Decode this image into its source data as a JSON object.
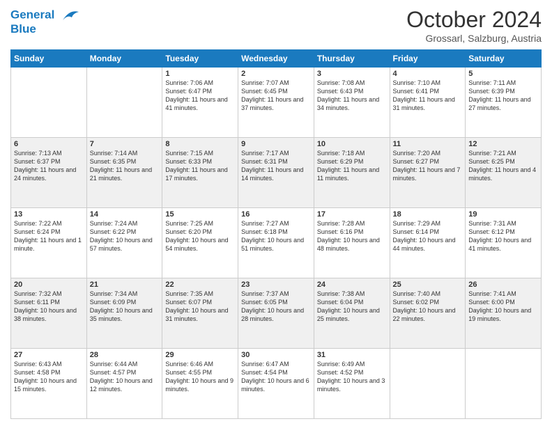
{
  "header": {
    "logo_line1": "General",
    "logo_line2": "Blue",
    "month": "October 2024",
    "location": "Grossarl, Salzburg, Austria"
  },
  "days_of_week": [
    "Sunday",
    "Monday",
    "Tuesday",
    "Wednesday",
    "Thursday",
    "Friday",
    "Saturday"
  ],
  "weeks": [
    [
      {
        "day": "",
        "sunrise": "",
        "sunset": "",
        "daylight": ""
      },
      {
        "day": "",
        "sunrise": "",
        "sunset": "",
        "daylight": ""
      },
      {
        "day": "1",
        "sunrise": "Sunrise: 7:06 AM",
        "sunset": "Sunset: 6:47 PM",
        "daylight": "Daylight: 11 hours and 41 minutes."
      },
      {
        "day": "2",
        "sunrise": "Sunrise: 7:07 AM",
        "sunset": "Sunset: 6:45 PM",
        "daylight": "Daylight: 11 hours and 37 minutes."
      },
      {
        "day": "3",
        "sunrise": "Sunrise: 7:08 AM",
        "sunset": "Sunset: 6:43 PM",
        "daylight": "Daylight: 11 hours and 34 minutes."
      },
      {
        "day": "4",
        "sunrise": "Sunrise: 7:10 AM",
        "sunset": "Sunset: 6:41 PM",
        "daylight": "Daylight: 11 hours and 31 minutes."
      },
      {
        "day": "5",
        "sunrise": "Sunrise: 7:11 AM",
        "sunset": "Sunset: 6:39 PM",
        "daylight": "Daylight: 11 hours and 27 minutes."
      }
    ],
    [
      {
        "day": "6",
        "sunrise": "Sunrise: 7:13 AM",
        "sunset": "Sunset: 6:37 PM",
        "daylight": "Daylight: 11 hours and 24 minutes."
      },
      {
        "day": "7",
        "sunrise": "Sunrise: 7:14 AM",
        "sunset": "Sunset: 6:35 PM",
        "daylight": "Daylight: 11 hours and 21 minutes."
      },
      {
        "day": "8",
        "sunrise": "Sunrise: 7:15 AM",
        "sunset": "Sunset: 6:33 PM",
        "daylight": "Daylight: 11 hours and 17 minutes."
      },
      {
        "day": "9",
        "sunrise": "Sunrise: 7:17 AM",
        "sunset": "Sunset: 6:31 PM",
        "daylight": "Daylight: 11 hours and 14 minutes."
      },
      {
        "day": "10",
        "sunrise": "Sunrise: 7:18 AM",
        "sunset": "Sunset: 6:29 PM",
        "daylight": "Daylight: 11 hours and 11 minutes."
      },
      {
        "day": "11",
        "sunrise": "Sunrise: 7:20 AM",
        "sunset": "Sunset: 6:27 PM",
        "daylight": "Daylight: 11 hours and 7 minutes."
      },
      {
        "day": "12",
        "sunrise": "Sunrise: 7:21 AM",
        "sunset": "Sunset: 6:25 PM",
        "daylight": "Daylight: 11 hours and 4 minutes."
      }
    ],
    [
      {
        "day": "13",
        "sunrise": "Sunrise: 7:22 AM",
        "sunset": "Sunset: 6:24 PM",
        "daylight": "Daylight: 11 hours and 1 minute."
      },
      {
        "day": "14",
        "sunrise": "Sunrise: 7:24 AM",
        "sunset": "Sunset: 6:22 PM",
        "daylight": "Daylight: 10 hours and 57 minutes."
      },
      {
        "day": "15",
        "sunrise": "Sunrise: 7:25 AM",
        "sunset": "Sunset: 6:20 PM",
        "daylight": "Daylight: 10 hours and 54 minutes."
      },
      {
        "day": "16",
        "sunrise": "Sunrise: 7:27 AM",
        "sunset": "Sunset: 6:18 PM",
        "daylight": "Daylight: 10 hours and 51 minutes."
      },
      {
        "day": "17",
        "sunrise": "Sunrise: 7:28 AM",
        "sunset": "Sunset: 6:16 PM",
        "daylight": "Daylight: 10 hours and 48 minutes."
      },
      {
        "day": "18",
        "sunrise": "Sunrise: 7:29 AM",
        "sunset": "Sunset: 6:14 PM",
        "daylight": "Daylight: 10 hours and 44 minutes."
      },
      {
        "day": "19",
        "sunrise": "Sunrise: 7:31 AM",
        "sunset": "Sunset: 6:12 PM",
        "daylight": "Daylight: 10 hours and 41 minutes."
      }
    ],
    [
      {
        "day": "20",
        "sunrise": "Sunrise: 7:32 AM",
        "sunset": "Sunset: 6:11 PM",
        "daylight": "Daylight: 10 hours and 38 minutes."
      },
      {
        "day": "21",
        "sunrise": "Sunrise: 7:34 AM",
        "sunset": "Sunset: 6:09 PM",
        "daylight": "Daylight: 10 hours and 35 minutes."
      },
      {
        "day": "22",
        "sunrise": "Sunrise: 7:35 AM",
        "sunset": "Sunset: 6:07 PM",
        "daylight": "Daylight: 10 hours and 31 minutes."
      },
      {
        "day": "23",
        "sunrise": "Sunrise: 7:37 AM",
        "sunset": "Sunset: 6:05 PM",
        "daylight": "Daylight: 10 hours and 28 minutes."
      },
      {
        "day": "24",
        "sunrise": "Sunrise: 7:38 AM",
        "sunset": "Sunset: 6:04 PM",
        "daylight": "Daylight: 10 hours and 25 minutes."
      },
      {
        "day": "25",
        "sunrise": "Sunrise: 7:40 AM",
        "sunset": "Sunset: 6:02 PM",
        "daylight": "Daylight: 10 hours and 22 minutes."
      },
      {
        "day": "26",
        "sunrise": "Sunrise: 7:41 AM",
        "sunset": "Sunset: 6:00 PM",
        "daylight": "Daylight: 10 hours and 19 minutes."
      }
    ],
    [
      {
        "day": "27",
        "sunrise": "Sunrise: 6:43 AM",
        "sunset": "Sunset: 4:58 PM",
        "daylight": "Daylight: 10 hours and 15 minutes."
      },
      {
        "day": "28",
        "sunrise": "Sunrise: 6:44 AM",
        "sunset": "Sunset: 4:57 PM",
        "daylight": "Daylight: 10 hours and 12 minutes."
      },
      {
        "day": "29",
        "sunrise": "Sunrise: 6:46 AM",
        "sunset": "Sunset: 4:55 PM",
        "daylight": "Daylight: 10 hours and 9 minutes."
      },
      {
        "day": "30",
        "sunrise": "Sunrise: 6:47 AM",
        "sunset": "Sunset: 4:54 PM",
        "daylight": "Daylight: 10 hours and 6 minutes."
      },
      {
        "day": "31",
        "sunrise": "Sunrise: 6:49 AM",
        "sunset": "Sunset: 4:52 PM",
        "daylight": "Daylight: 10 hours and 3 minutes."
      },
      {
        "day": "",
        "sunrise": "",
        "sunset": "",
        "daylight": ""
      },
      {
        "day": "",
        "sunrise": "",
        "sunset": "",
        "daylight": ""
      }
    ]
  ]
}
